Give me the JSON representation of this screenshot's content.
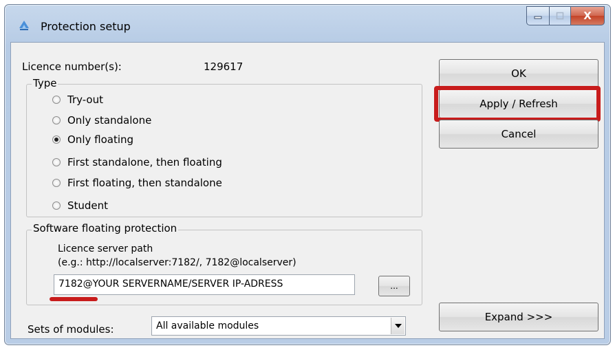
{
  "window": {
    "title": "Protection setup",
    "controls": {
      "minimize": "–",
      "maximize": "□",
      "close": "X"
    }
  },
  "licence": {
    "label": "Licence number(s):",
    "value": "129617"
  },
  "type_group": {
    "legend": "Type",
    "options": [
      {
        "label": "Try-out",
        "checked": false
      },
      {
        "label": "Only standalone",
        "checked": false
      },
      {
        "label": "Only floating",
        "checked": true
      },
      {
        "label": "First standalone, then floating",
        "checked": false
      },
      {
        "label": "First floating, then standalone",
        "checked": false
      },
      {
        "label": "Student",
        "checked": false
      }
    ]
  },
  "floating_group": {
    "legend": "Software floating protection",
    "path_label": "Licence server path",
    "path_hint": "(e.g.: http://localserver:7182/, 7182@localserver)",
    "path_value": "7182@YOUR SERVERNAME/SERVER IP-ADRESS",
    "browse_label": "..."
  },
  "modules": {
    "label": "Sets of modules:",
    "selected": "All available modules"
  },
  "buttons": {
    "ok": "OK",
    "apply": "Apply / Refresh",
    "cancel": "Cancel",
    "expand": "Expand >>>"
  },
  "colors": {
    "highlight": "#c81c1c",
    "title_bar": "#b9cde6",
    "client_bg": "#f0f0f0"
  }
}
